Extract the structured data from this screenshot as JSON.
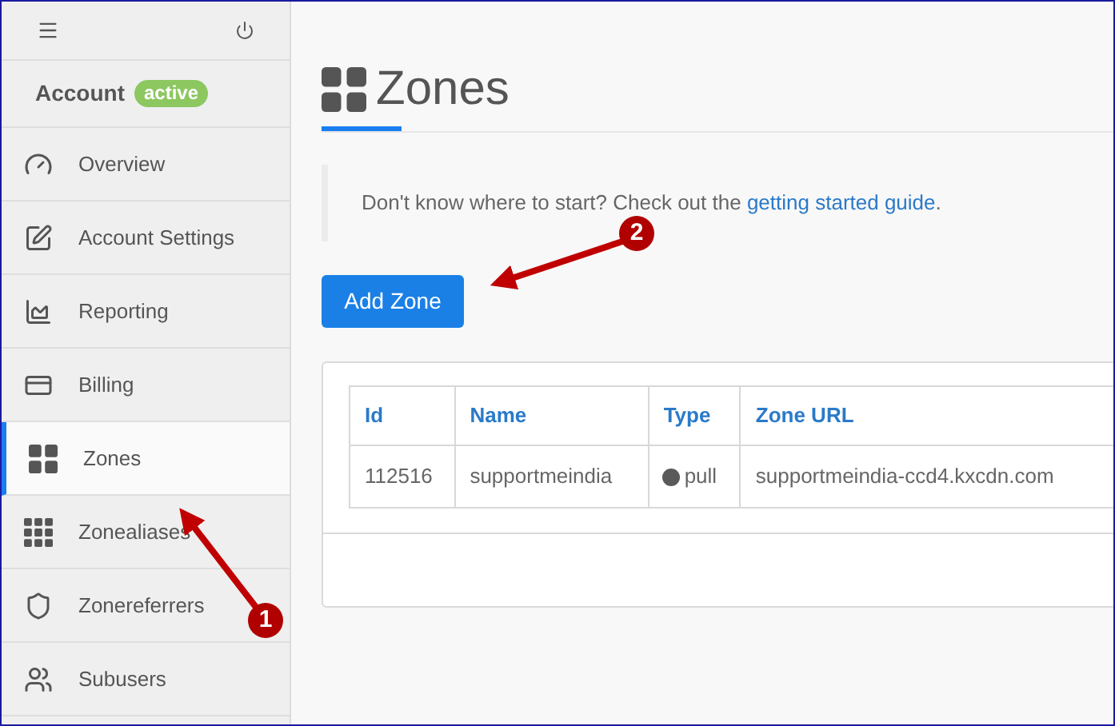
{
  "sidebar": {
    "account": {
      "label": "Account",
      "badge": "active"
    },
    "items": [
      {
        "label": "Overview",
        "selected": false
      },
      {
        "label": "Account Settings",
        "selected": false
      },
      {
        "label": "Reporting",
        "selected": false
      },
      {
        "label": "Billing",
        "selected": false
      },
      {
        "label": "Zones",
        "selected": true
      },
      {
        "label": "Zonealiases",
        "selected": false
      },
      {
        "label": "Zonereferrers",
        "selected": false
      },
      {
        "label": "Subusers",
        "selected": false
      }
    ]
  },
  "page": {
    "title": "Zones",
    "notice": "Don't know where to start? Check out the ",
    "notice_link": "getting started guide",
    "notice_end": ".",
    "add_button": "Add Zone"
  },
  "table": {
    "columns": [
      "Id",
      "Name",
      "Type",
      "Zone URL"
    ],
    "rows": [
      {
        "id": "112516",
        "name": "supportmeindia",
        "type": "pull",
        "url": "supportmeindia-ccd4.kxcdn.com",
        "color": "#5a5a5a"
      }
    ]
  },
  "annotations": [
    {
      "number": "1"
    },
    {
      "number": "2"
    }
  ]
}
